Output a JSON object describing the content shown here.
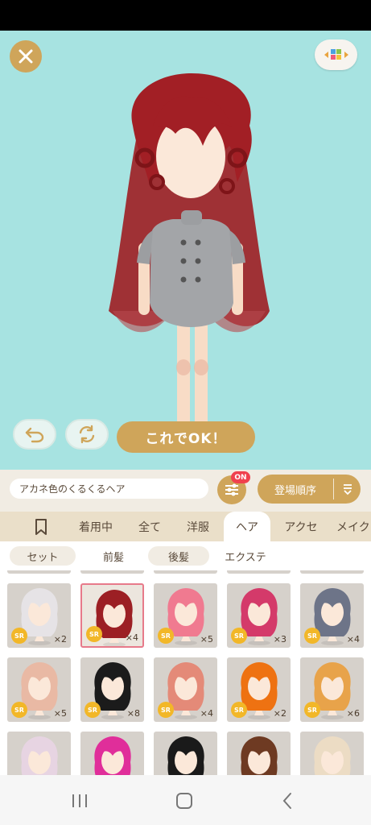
{
  "header": {
    "close_icon": "close-icon",
    "palette_icon": "color-palette-icon"
  },
  "controls": {
    "undo_icon": "undo-icon",
    "rotate_icon": "rotate-icon",
    "ok_label": "これでOK！"
  },
  "filter": {
    "search_value": "アカネ色のくるくるヘア",
    "filter_badge": "ON",
    "sort_label": "登場順序"
  },
  "tabs": [
    {
      "label": "",
      "icon": "bookmark-icon"
    },
    {
      "label": "着用中"
    },
    {
      "label": "全て"
    },
    {
      "label": "洋服"
    },
    {
      "label": "ヘア"
    },
    {
      "label": "アクセ"
    },
    {
      "label": "メイク"
    }
  ],
  "active_tab": "ヘア",
  "subtabs": [
    {
      "label": "セット"
    },
    {
      "label": "前髪"
    },
    {
      "label": "後髪"
    },
    {
      "label": "エクステ"
    }
  ],
  "items": [
    {
      "rarity": "SR",
      "count": "×2",
      "hair_color": "#e6e3e6"
    },
    {
      "rarity": "SR",
      "count": "×4",
      "hair_color": "#9c1f24",
      "selected": true
    },
    {
      "rarity": "SR",
      "count": "×5",
      "hair_color": "#f07a90"
    },
    {
      "rarity": "SR",
      "count": "×3",
      "hair_color": "#d43a6a"
    },
    {
      "rarity": "SR",
      "count": "×4",
      "hair_color": "#6d7488"
    },
    {
      "rarity": "SR",
      "count": "×5",
      "hair_color": "#e9b9a4"
    },
    {
      "rarity": "SR",
      "count": "×8",
      "hair_color": "#1b1b1b"
    },
    {
      "rarity": "SR",
      "count": "×4",
      "hair_color": "#e48a78"
    },
    {
      "rarity": "SR",
      "count": "×2",
      "hair_color": "#ee7212"
    },
    {
      "rarity": "SR",
      "count": "×6",
      "hair_color": "#e8a34a"
    },
    {
      "rarity": "",
      "count": "",
      "hair_color": "#e7d4e2"
    },
    {
      "rarity": "",
      "count": "",
      "hair_color": "#e02e9a"
    },
    {
      "rarity": "",
      "count": "",
      "hair_color": "#1a1a1a"
    },
    {
      "rarity": "",
      "count": "",
      "hair_color": "#6e3a22"
    },
    {
      "rarity": "",
      "count": "",
      "hair_color": "#ecdcc4"
    }
  ],
  "navbar": {
    "recent_icon": "recent-apps-icon",
    "home_icon": "home-icon",
    "back_icon": "back-icon"
  },
  "colors": {
    "accent_gold": "#cfa55a",
    "stage_bg": "#a7e3e1",
    "badge_red": "#f0414e",
    "sr_yellow": "#f2b728"
  }
}
